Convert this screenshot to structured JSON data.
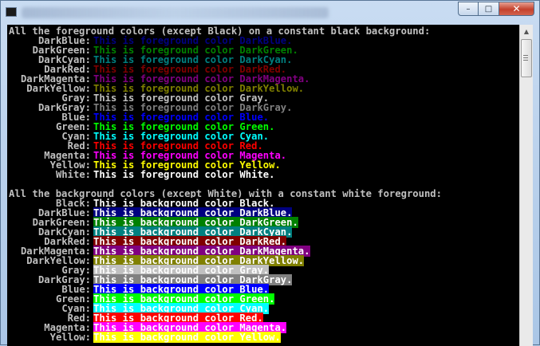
{
  "colors": {
    "Black": "#000000",
    "DarkBlue": "#000080",
    "DarkGreen": "#008000",
    "DarkCyan": "#008080",
    "DarkRed": "#800000",
    "DarkMagenta": "#800080",
    "DarkYellow": "#808000",
    "Gray": "#c0c0c0",
    "DarkGray": "#808080",
    "Blue": "#0000ff",
    "Green": "#00ff00",
    "Cyan": "#00ffff",
    "Red": "#ff0000",
    "Magenta": "#ff00ff",
    "Yellow": "#ffff00",
    "White": "#ffffff"
  },
  "window": {
    "controls": {
      "minimize_icon": "minimize-icon",
      "maximize_icon": "maximize-icon",
      "close_icon": "close-icon"
    },
    "minimize_glyph": "–",
    "maximize_glyph": "□",
    "close_glyph": "✕"
  },
  "scrollbar": {
    "up_glyph": "▲"
  },
  "foreground_section": {
    "header": "All the foreground colors (except Black) on a constant black background:",
    "rows": [
      {
        "label": "DarkBlue:",
        "text": "This is foreground color DarkBlue.",
        "color": "DarkBlue"
      },
      {
        "label": "DarkGreen:",
        "text": "This is foreground color DarkGreen.",
        "color": "DarkGreen"
      },
      {
        "label": "DarkCyan:",
        "text": "This is foreground color DarkCyan.",
        "color": "DarkCyan"
      },
      {
        "label": "DarkRed:",
        "text": "This is foreground color DarkRed.",
        "color": "DarkRed"
      },
      {
        "label": "DarkMagenta:",
        "text": "This is foreground color DarkMagenta.",
        "color": "DarkMagenta"
      },
      {
        "label": "DarkYellow:",
        "text": "This is foreground color DarkYellow.",
        "color": "DarkYellow"
      },
      {
        "label": "Gray:",
        "text": "This is foreground color Gray.",
        "color": "Gray"
      },
      {
        "label": "DarkGray:",
        "text": "This is foreground color DarkGray.",
        "color": "DarkGray"
      },
      {
        "label": "Blue:",
        "text": "This is foreground color Blue.",
        "color": "Blue"
      },
      {
        "label": "Green:",
        "text": "This is foreground color Green.",
        "color": "Green"
      },
      {
        "label": "Cyan:",
        "text": "This is foreground color Cyan.",
        "color": "Cyan"
      },
      {
        "label": "Red:",
        "text": "This is foreground color Red.",
        "color": "Red"
      },
      {
        "label": "Magenta:",
        "text": "This is foreground color Magenta.",
        "color": "Magenta"
      },
      {
        "label": "Yellow:",
        "text": "This is foreground color Yellow.",
        "color": "Yellow"
      },
      {
        "label": "White:",
        "text": "This is foreground color White.",
        "color": "White"
      }
    ]
  },
  "background_section": {
    "header": "All the background colors (except White) with a constant white foreground:",
    "rows": [
      {
        "label": "Black:",
        "text": "This is background color Black.",
        "color": "Black"
      },
      {
        "label": "DarkBlue:",
        "text": "This is background color DarkBlue.",
        "color": "DarkBlue"
      },
      {
        "label": "DarkGreen:",
        "text": "This is background color DarkGreen.",
        "color": "DarkGreen"
      },
      {
        "label": "DarkCyan:",
        "text": "This is background color DarkCyan.",
        "color": "DarkCyan"
      },
      {
        "label": "DarkRed:",
        "text": "This is background color DarkRed.",
        "color": "DarkRed"
      },
      {
        "label": "DarkMagenta:",
        "text": "This is background color DarkMagenta.",
        "color": "DarkMagenta"
      },
      {
        "label": "DarkYellow:",
        "text": "This is background color DarkYellow.",
        "color": "DarkYellow"
      },
      {
        "label": "Gray:",
        "text": "This is background color Gray.",
        "color": "Gray"
      },
      {
        "label": "DarkGray:",
        "text": "This is background color DarkGray.",
        "color": "DarkGray"
      },
      {
        "label": "Blue:",
        "text": "This is background color Blue.",
        "color": "Blue"
      },
      {
        "label": "Green:",
        "text": "This is background color Green.",
        "color": "Green"
      },
      {
        "label": "Cyan:",
        "text": "This is background color Cyan.",
        "color": "Cyan"
      },
      {
        "label": "Red:",
        "text": "This is background color Red.",
        "color": "Red"
      },
      {
        "label": "Magenta:",
        "text": "This is background color Magenta.",
        "color": "Magenta"
      },
      {
        "label": "Yellow:",
        "text": "This is background color Yellow.",
        "color": "Yellow"
      }
    ]
  }
}
